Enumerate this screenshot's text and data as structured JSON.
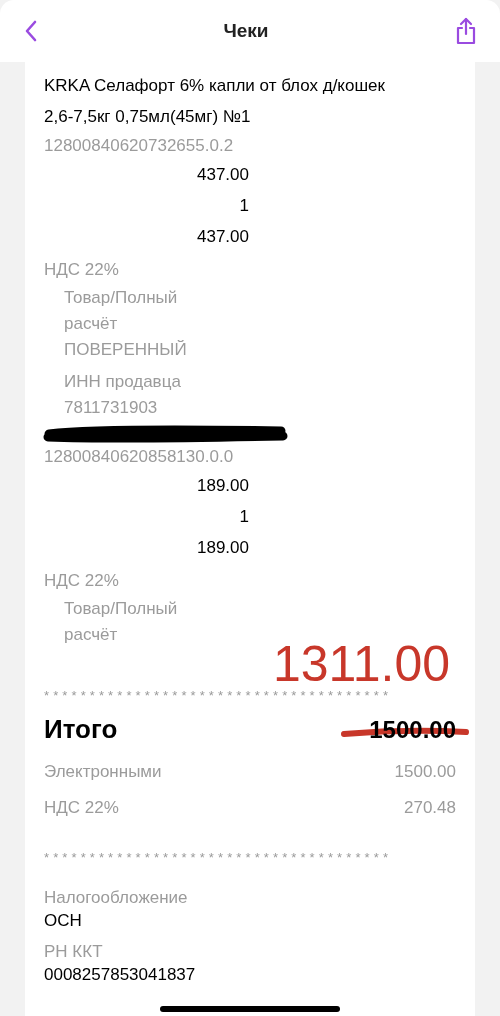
{
  "header": {
    "title": "Чеки"
  },
  "items": [
    {
      "kind": "plain",
      "name": "KRKA Селафорт 6% капли от блох д/кошек 2,6-7,5кг 0,75мл(45мг) №1",
      "code": "12800840620732655.0.2",
      "price": "437.00",
      "quantity": "1",
      "total": "437.00",
      "vat": "НДС 22%",
      "details": [
        "Товар/Полный расчёт",
        "ПОВЕРЕННЫЙ"
      ],
      "seller": {
        "label": "ИНН продавца",
        "value": "7811731903"
      }
    },
    {
      "kind": "redacted",
      "code": "12800840620858130.0.0",
      "price": "189.00",
      "quantity": "1",
      "total": "189.00",
      "vat": "НДС 22%",
      "details": [
        "Товар/Полный расчёт"
      ]
    }
  ],
  "separator": "**************************************",
  "total": {
    "label": "Итого",
    "value": "1500.00",
    "crossed_out": true,
    "handwritten": "1311.00"
  },
  "payments": [
    {
      "label": "Электронными",
      "value": "1500.00"
    },
    {
      "label": "НДС 22%",
      "value": "270.48"
    }
  ],
  "fields": [
    {
      "label": "Налогообложение",
      "value": "ОСН"
    },
    {
      "label": "РН ККТ",
      "value": "0008257853041837"
    }
  ]
}
